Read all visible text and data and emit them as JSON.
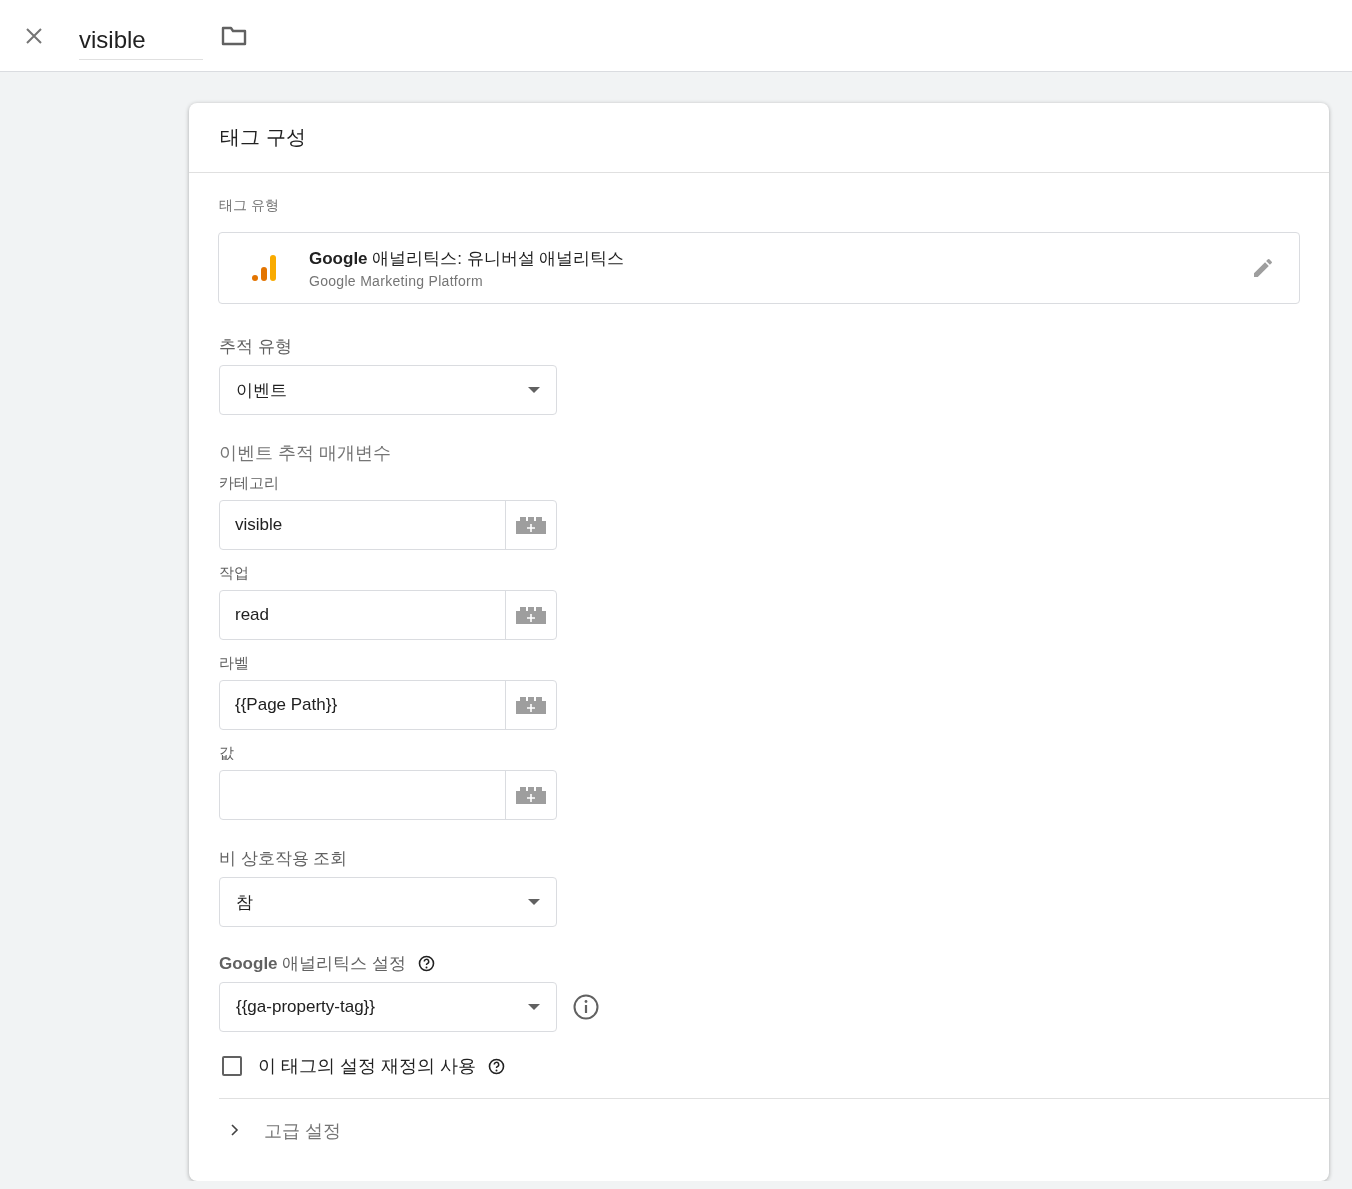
{
  "header": {
    "name": "visible"
  },
  "card": {
    "title": "태그 구성",
    "tag_type": {
      "label": "태그 유형",
      "name": "**Google** 애널리틱스: 유니버설 애널리틱스",
      "vendor": "Google Marketing Platform"
    },
    "tracking_type": {
      "label": "추적 유형",
      "value": "이벤트"
    },
    "event_params": {
      "label": "이벤트 추적 매개변수",
      "fields": [
        {
          "label": "카테고리",
          "value": "visible"
        },
        {
          "label": "작업",
          "value": "read"
        },
        {
          "label": "라벨",
          "value": "{{Page Path}}"
        },
        {
          "label": "값"
        }
      ]
    },
    "non_interaction": {
      "label": "비 상호작용 조회",
      "value": "참"
    },
    "ga_settings": {
      "label": "**Google** 애널리틱스 설정",
      "value": "{{ga-property-tag}}"
    },
    "override": {
      "label": "이 태그의 설정 재정의 사용",
      "checked": false
    },
    "advanced": {
      "label": "고급 설정",
      "expanded": false
    }
  }
}
